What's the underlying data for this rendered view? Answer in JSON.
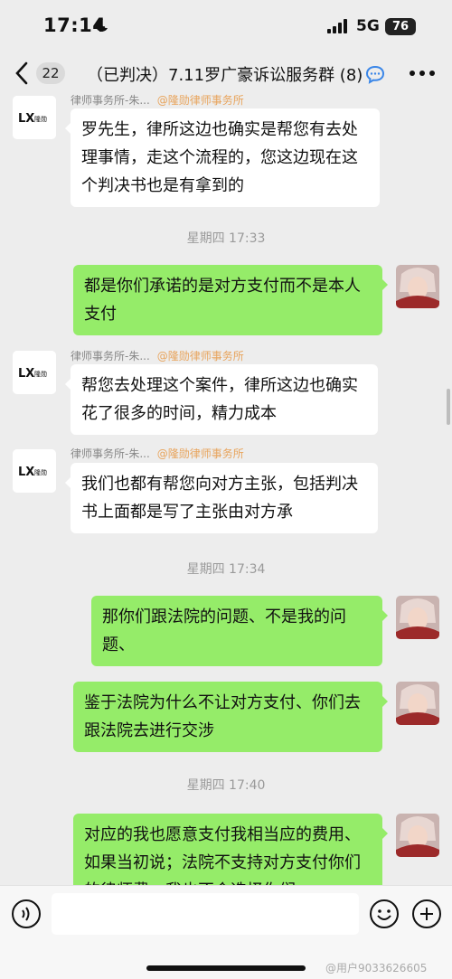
{
  "status": {
    "time": "17:14",
    "network": "5G",
    "battery": "76"
  },
  "header": {
    "unread": "22",
    "title": "（已判决）7.11罗广豪诉讼服务群 (8)"
  },
  "messages": [
    {
      "sender": "律师事务所-朱...",
      "org": "@隆勋律师事务所",
      "text": "罗先生，律所这边也确实是帮您有去处理事情，走这个流程的，您这边现在这个判决书也是有拿到的"
    },
    {
      "stamp": "星期四 17:33"
    },
    {
      "text": "都是你们承诺的是对方支付而不是本人支付"
    },
    {
      "sender": "律师事务所-朱...",
      "org": "@隆勋律师事务所",
      "text": "帮您去处理这个案件，律所这边也确实花了很多的时间，精力成本"
    },
    {
      "sender": "律师事务所-朱...",
      "org": "@隆勋律师事务所",
      "text": "我们也都有帮您向对方主张，包括判决书上面都是写了主张由对方承"
    },
    {
      "stamp": "星期四 17:34"
    },
    {
      "text": "那你们跟法院的问题、不是我的问题、"
    },
    {
      "text": "鉴于法院为什么不让对方支付、你们去跟法院去进行交涉"
    },
    {
      "stamp": "星期四 17:40"
    },
    {
      "text": "对应的我也愿意支付我相当应的费用、如果当初说；法院不支持对方支付你们的律师费，我也不会选择你们"
    }
  ],
  "firm_logo_text": "隆勋",
  "watermark": "@用户9033626605",
  "colors": {
    "outgoing": "#95ec69",
    "incoming": "#ffffff",
    "background": "#ededed",
    "org_tag": "#e8a45c"
  },
  "icons": [
    "moon-icon",
    "signal-icon",
    "back-icon",
    "chat-bubble-icon",
    "more-icon",
    "voice-icon",
    "emoji-icon",
    "plus-icon"
  ]
}
